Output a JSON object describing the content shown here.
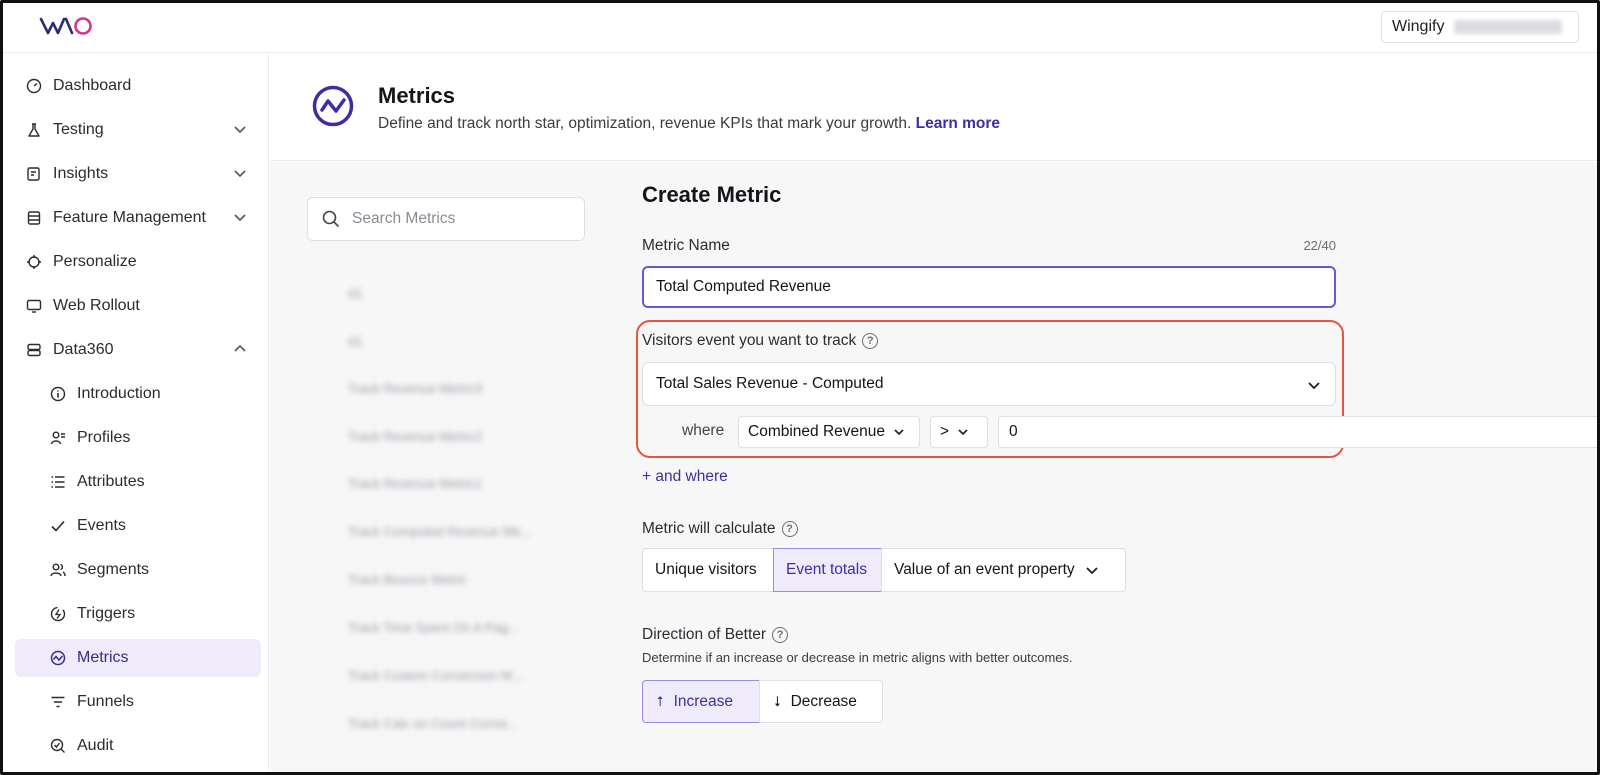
{
  "brand": {
    "logo": "VWO",
    "accent": "#6b56d0",
    "link_color": "#3e2ea6",
    "highlight_color": "#e6533f"
  },
  "account": {
    "name": "Wingify"
  },
  "sidebar": {
    "items": [
      {
        "label": "Dashboard",
        "icon": "gauge-icon"
      },
      {
        "label": "Testing",
        "icon": "flask-icon",
        "expandable": true
      },
      {
        "label": "Insights",
        "icon": "insights-icon",
        "expandable": true
      },
      {
        "label": "Feature Management",
        "icon": "feature-icon",
        "expandable": true
      },
      {
        "label": "Personalize",
        "icon": "target-icon"
      },
      {
        "label": "Web Rollout",
        "icon": "rollout-icon"
      },
      {
        "label": "Data360",
        "icon": "database-icon",
        "expanded": true
      },
      {
        "label": "Introduction",
        "icon": "info-icon"
      },
      {
        "label": "Profiles",
        "icon": "profiles-icon"
      },
      {
        "label": "Attributes",
        "icon": "list-icon"
      },
      {
        "label": "Events",
        "icon": "check-icon"
      },
      {
        "label": "Segments",
        "icon": "users-icon"
      },
      {
        "label": "Triggers",
        "icon": "trigger-icon"
      },
      {
        "label": "Metrics",
        "icon": "metrics-icon",
        "active": true
      },
      {
        "label": "Funnels",
        "icon": "funnel-icon"
      },
      {
        "label": "Audit",
        "icon": "audit-icon"
      }
    ]
  },
  "header": {
    "title": "Metrics",
    "description": "Define and track north star, optimization, revenue KPIs that mark your growth.",
    "learn_more": "Learn more"
  },
  "search": {
    "placeholder": "Search Metrics"
  },
  "metric_list": {
    "items": [
      "d1",
      "d1",
      "Track Revenue Metric3",
      "Track Revenue Metric2",
      "Track Revenue Metric1",
      "Track Computed Revenue Me...",
      "Track Bounce Metric",
      "Track Time Spent On A Pag...",
      "Track Custom Conversion M...",
      "Track Calc on Count Conve..."
    ]
  },
  "form": {
    "heading": "Create Metric",
    "name_label": "Metric Name",
    "name_counter": "22/40",
    "name_value": "Total Computed Revenue",
    "event_label": "Visitors event you want to track",
    "event_value": "Total Sales Revenue - Computed",
    "where_label": "where",
    "property_value": "Combined Revenue",
    "operator_value": ">",
    "condition_value": "0",
    "and_where": "+ and where",
    "calc_label": "Metric will calculate",
    "calc_options": [
      "Unique visitors",
      "Event totals",
      "Value of an event property"
    ],
    "calc_selected": "Event totals",
    "direction_label": "Direction of Better",
    "direction_desc": "Determine if an increase or decrease in metric aligns with better outcomes.",
    "direction_options": [
      "Increase",
      "Decrease"
    ],
    "direction_selected": "Increase"
  }
}
